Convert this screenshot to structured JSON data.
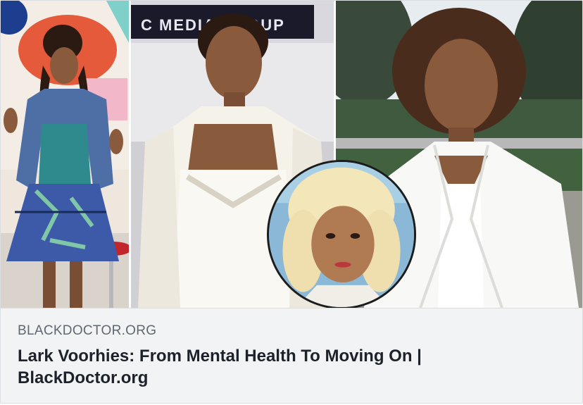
{
  "link_preview": {
    "domain": "BLACKDOCTOR.ORG",
    "title": "Lark Voorhies: From Mental Health To Moving On | BlackDoctor.org"
  },
  "images": {
    "panel_1": "young woman in patterned strapless dress and denim jacket",
    "panel_2": "woman in white satin dress at media event",
    "panel_3": "woman in white blazer outdoors",
    "inset": "woman with platinum blonde hair"
  },
  "backdrop_text": "C MEDIA GROUP"
}
